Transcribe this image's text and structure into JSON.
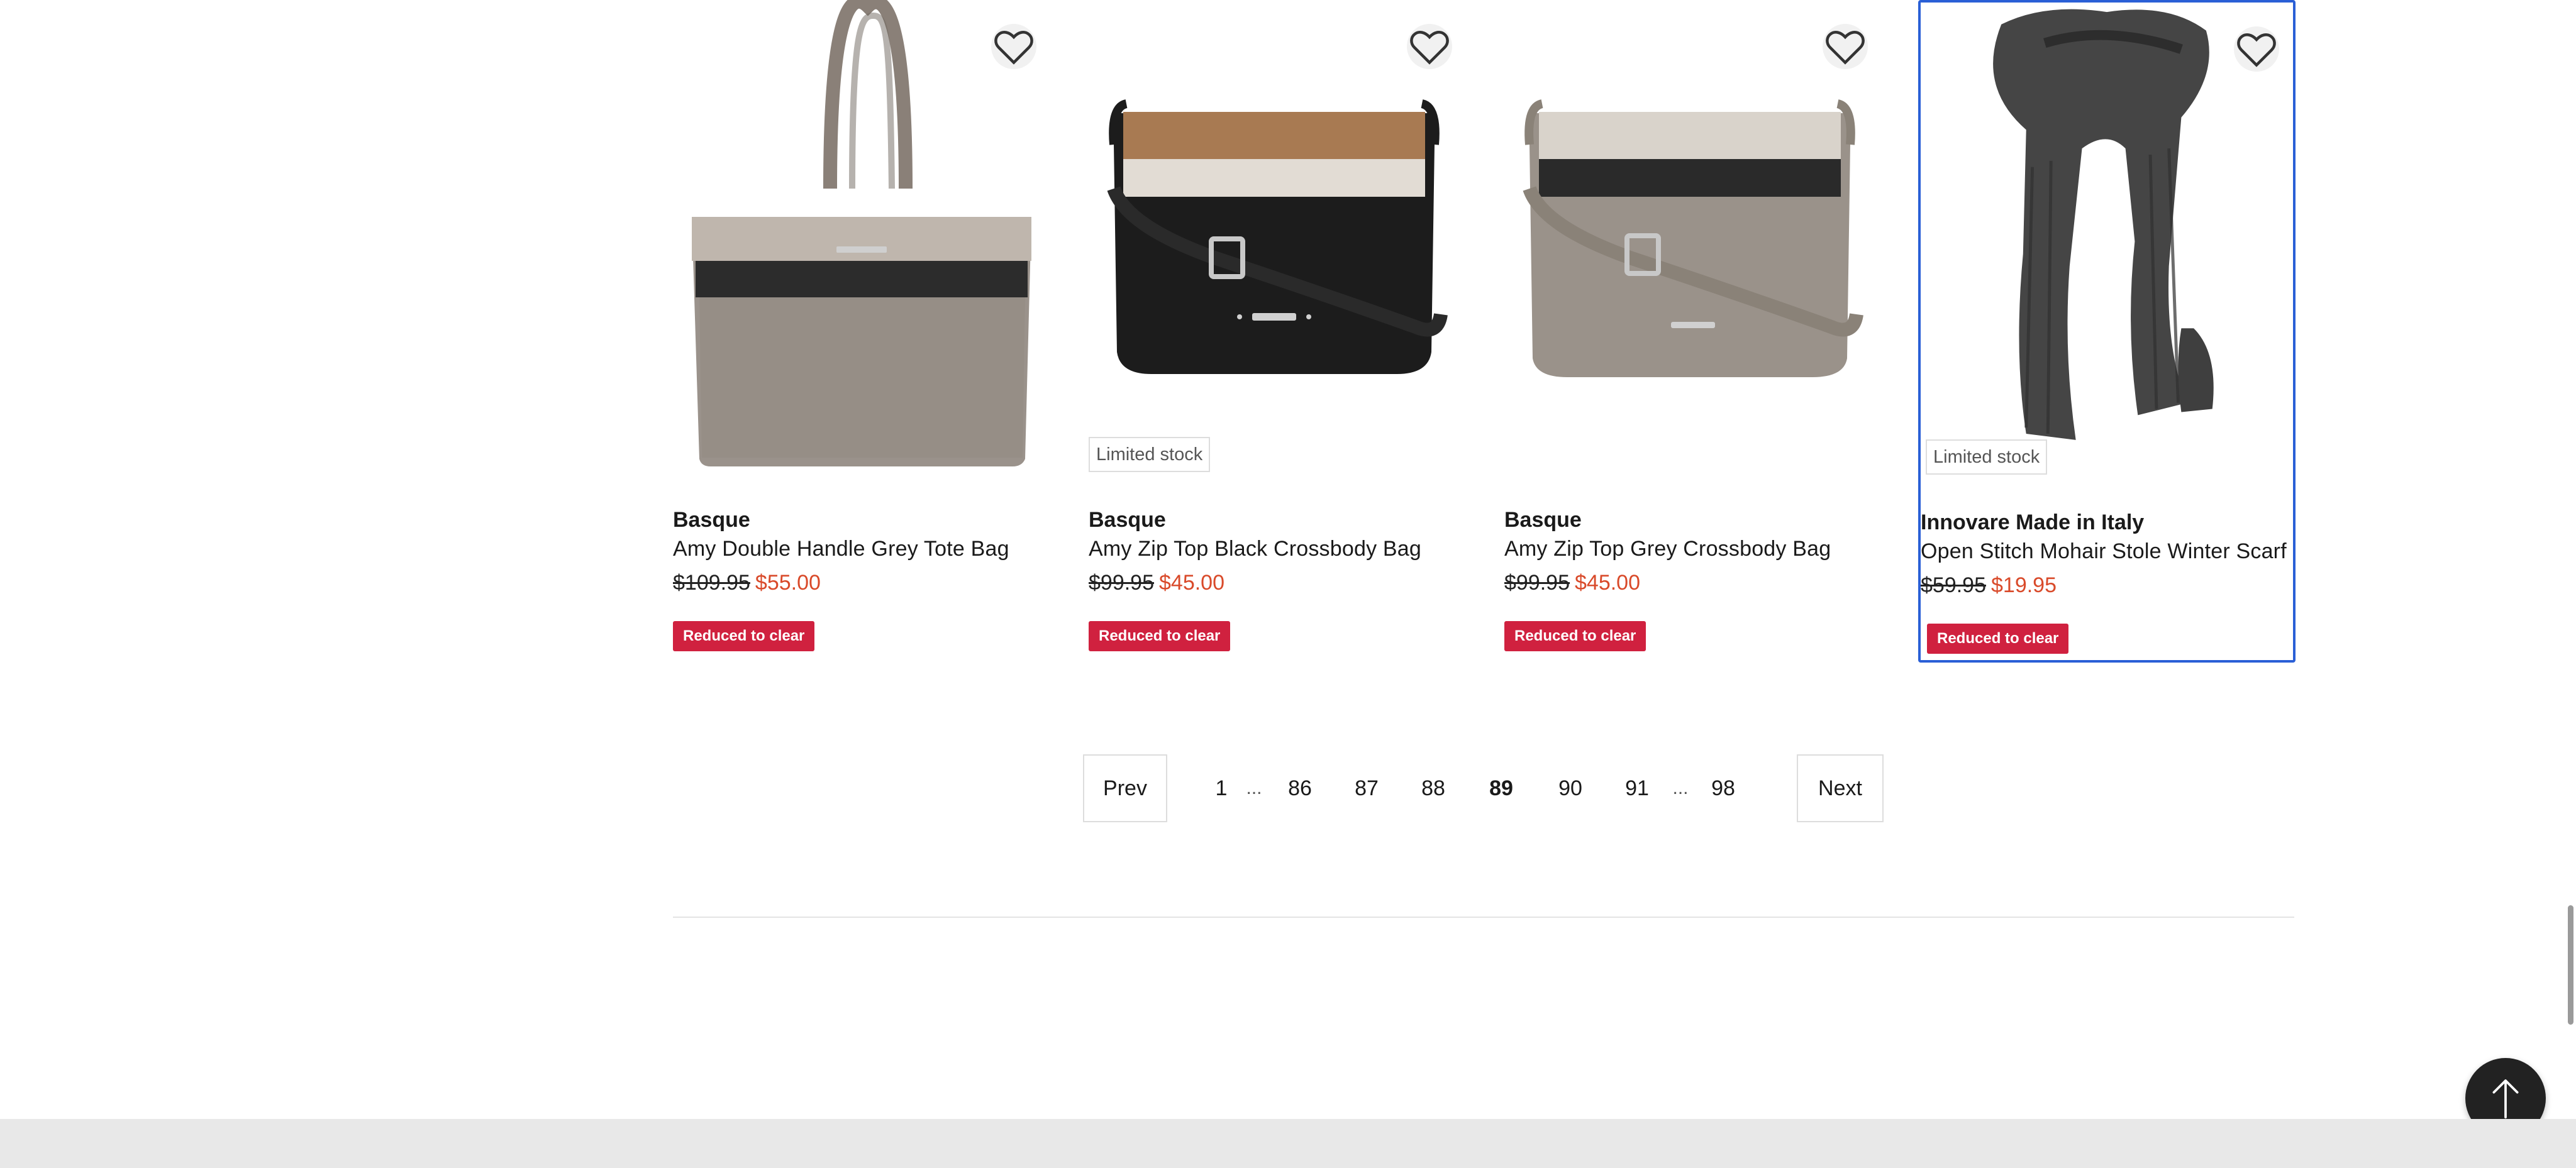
{
  "products": [
    {
      "brand": "Basque",
      "name": "Amy Double Handle Grey Tote Bag",
      "price_was": "$109.95",
      "price_now": "$55.00",
      "badge": "Reduced to clear",
      "limited_stock": null,
      "selected": false
    },
    {
      "brand": "Basque",
      "name": "Amy Zip Top Black Crossbody Bag",
      "price_was": "$99.95",
      "price_now": "$45.00",
      "badge": "Reduced to clear",
      "limited_stock": "Limited stock",
      "selected": false
    },
    {
      "brand": "Basque",
      "name": "Amy Zip Top Grey Crossbody Bag",
      "price_was": "$99.95",
      "price_now": "$45.00",
      "badge": "Reduced to clear",
      "limited_stock": null,
      "selected": false
    },
    {
      "brand": "Innovare Made in Italy",
      "name": "Open Stitch Mohair Stole Winter Scarf",
      "price_was": "$59.95",
      "price_now": "$19.95",
      "badge": "Reduced to clear",
      "limited_stock": "Limited stock",
      "selected": true
    }
  ],
  "pagination": {
    "prev_label": "Prev",
    "next_label": "Next",
    "pages": [
      "1",
      "86",
      "87",
      "88",
      "89",
      "90",
      "91",
      "98"
    ],
    "ellipsis": "...",
    "current": "89"
  },
  "icons": {
    "wishlist": "heart-outline-icon",
    "back_to_top": "arrow-up-icon"
  },
  "colors": {
    "sale_price": "#d94a2a",
    "badge_bg": "#d0213f",
    "selected_border": "#2a5fd6",
    "back_to_top_bg": "#222222"
  }
}
